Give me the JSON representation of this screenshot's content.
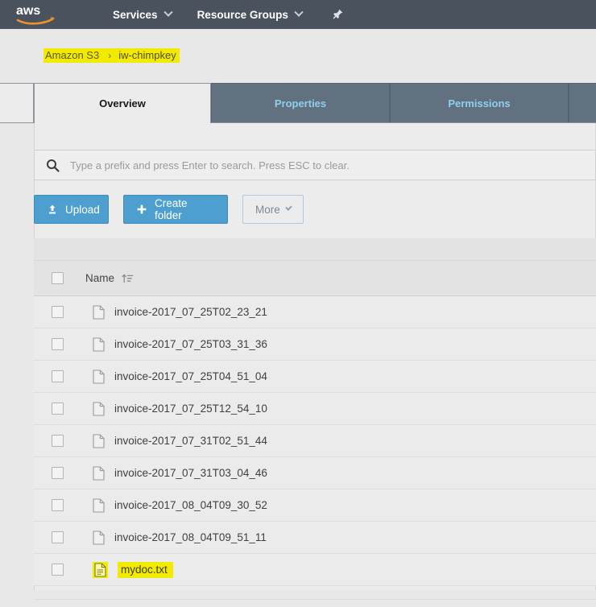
{
  "navbar": {
    "logo_alt": "aws",
    "services_label": "Services",
    "resource_groups_label": "Resource Groups",
    "pin_icon": "pushpin-icon",
    "background_color": "#4a525e"
  },
  "breadcrumb": {
    "root_label": "Amazon S3",
    "separator": "›",
    "current_label": "iw-chimpkey",
    "highlight_color": "#f2ea00"
  },
  "tabs": [
    {
      "label": "Overview",
      "active": true
    },
    {
      "label": "Properties",
      "active": false
    },
    {
      "label": "Permissions",
      "active": false
    },
    {
      "label": "",
      "active": false
    }
  ],
  "search": {
    "icon": "search-icon",
    "placeholder": "Type a prefix and press Enter to search. Press ESC to clear.",
    "value": ""
  },
  "toolbar": {
    "upload_label": "Upload",
    "upload_icon": "upload-icon",
    "create_folder_label": "Create folder",
    "create_folder_icon": "plus-icon",
    "more_label": "More",
    "more_icon": "chevron-down-icon",
    "primary_color": "#4d9fcf"
  },
  "table": {
    "select_all_checkbox": "",
    "columns": [
      {
        "label": "Name",
        "sort_icon": "sort-ascending-icon"
      }
    ],
    "rows": [
      {
        "name": "invoice-2017_07_25T02_23_21",
        "icon": "file-icon",
        "highlighted": false
      },
      {
        "name": "invoice-2017_07_25T03_31_36",
        "icon": "file-icon",
        "highlighted": false
      },
      {
        "name": "invoice-2017_07_25T04_51_04",
        "icon": "file-icon",
        "highlighted": false
      },
      {
        "name": "invoice-2017_07_25T12_54_10",
        "icon": "file-icon",
        "highlighted": false
      },
      {
        "name": "invoice-2017_07_31T02_51_44",
        "icon": "file-icon",
        "highlighted": false
      },
      {
        "name": "invoice-2017_07_31T03_04_46",
        "icon": "file-icon",
        "highlighted": false
      },
      {
        "name": "invoice-2017_08_04T09_30_52",
        "icon": "file-icon",
        "highlighted": false
      },
      {
        "name": "invoice-2017_08_04T09_51_11",
        "icon": "file-icon",
        "highlighted": false
      },
      {
        "name": "mydoc.txt",
        "icon": "text-file-icon",
        "highlighted": true
      }
    ]
  }
}
